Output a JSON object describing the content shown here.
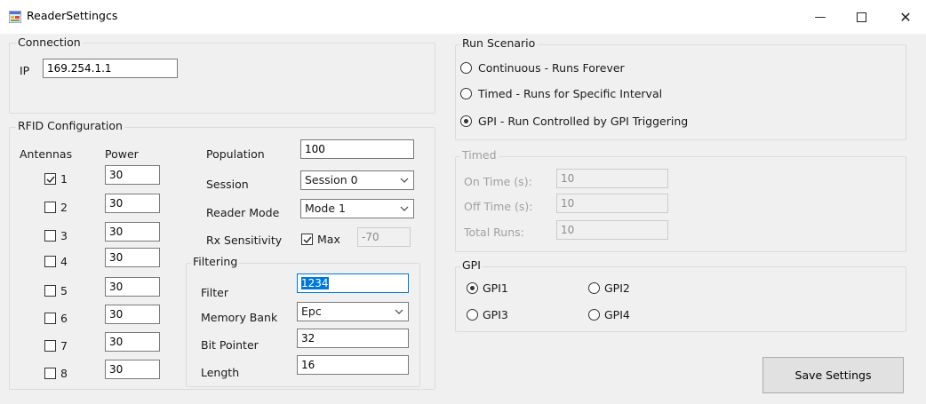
{
  "window": {
    "title": "ReaderSettingcs",
    "minimize_glyph": "—",
    "close_glyph": "✕",
    "icon": "app-form-icon"
  },
  "connection": {
    "legend": "Connection",
    "ip_label": "IP",
    "ip_value": "169.254.1.1"
  },
  "rfid": {
    "legend": "RFID Configuration",
    "antennas_header": "Antennas",
    "power_header": "Power",
    "antennas": [
      {
        "label": "1",
        "checked": true,
        "power": "30"
      },
      {
        "label": "2",
        "checked": false,
        "power": "30"
      },
      {
        "label": "3",
        "checked": false,
        "power": "30"
      },
      {
        "label": "4",
        "checked": false,
        "power": "30"
      },
      {
        "label": "5",
        "checked": false,
        "power": "30"
      },
      {
        "label": "6",
        "checked": false,
        "power": "30"
      },
      {
        "label": "7",
        "checked": false,
        "power": "30"
      },
      {
        "label": "8",
        "checked": false,
        "power": "30"
      }
    ],
    "population_label": "Population",
    "population_value": "100",
    "session_label": "Session",
    "session_value": "Session 0",
    "reader_mode_label": "Reader Mode",
    "reader_mode_value": "Mode 1",
    "rx_label": "Rx Sensitivity",
    "rx_max_label": "Max",
    "rx_max_checked": true,
    "rx_value": "-70"
  },
  "filtering": {
    "legend": "Filtering",
    "filter_label": "Filter",
    "filter_value": "1234",
    "memory_bank_label": "Memory Bank",
    "memory_bank_value": "Epc",
    "bit_pointer_label": "Bit Pointer",
    "bit_pointer_value": "32",
    "length_label": "Length",
    "length_value": "16"
  },
  "run_scenario": {
    "legend": "Run Scenario",
    "options": [
      {
        "label": "Continuous - Runs Forever",
        "selected": false
      },
      {
        "label": "Timed - Runs for Specific Interval",
        "selected": false
      },
      {
        "label": "GPI - Run Controlled by GPI Triggering",
        "selected": true
      }
    ]
  },
  "timed": {
    "legend": "Timed",
    "on_time_label": "On Time (s):",
    "on_time_value": "10",
    "off_time_label": "Off Time (s):",
    "off_time_value": "10",
    "total_runs_label": "Total Runs:",
    "total_runs_value": "10"
  },
  "gpi": {
    "legend": "GPI",
    "options": [
      {
        "label": "GPI1",
        "selected": true
      },
      {
        "label": "GPI2",
        "selected": false
      },
      {
        "label": "GPI3",
        "selected": false
      },
      {
        "label": "GPI4",
        "selected": false
      }
    ]
  },
  "save_button_label": "Save Settings",
  "colors": {
    "window_bg": "#f0f0f0",
    "selection": "#0078d7",
    "disabled_text": "#a0a0a0"
  }
}
